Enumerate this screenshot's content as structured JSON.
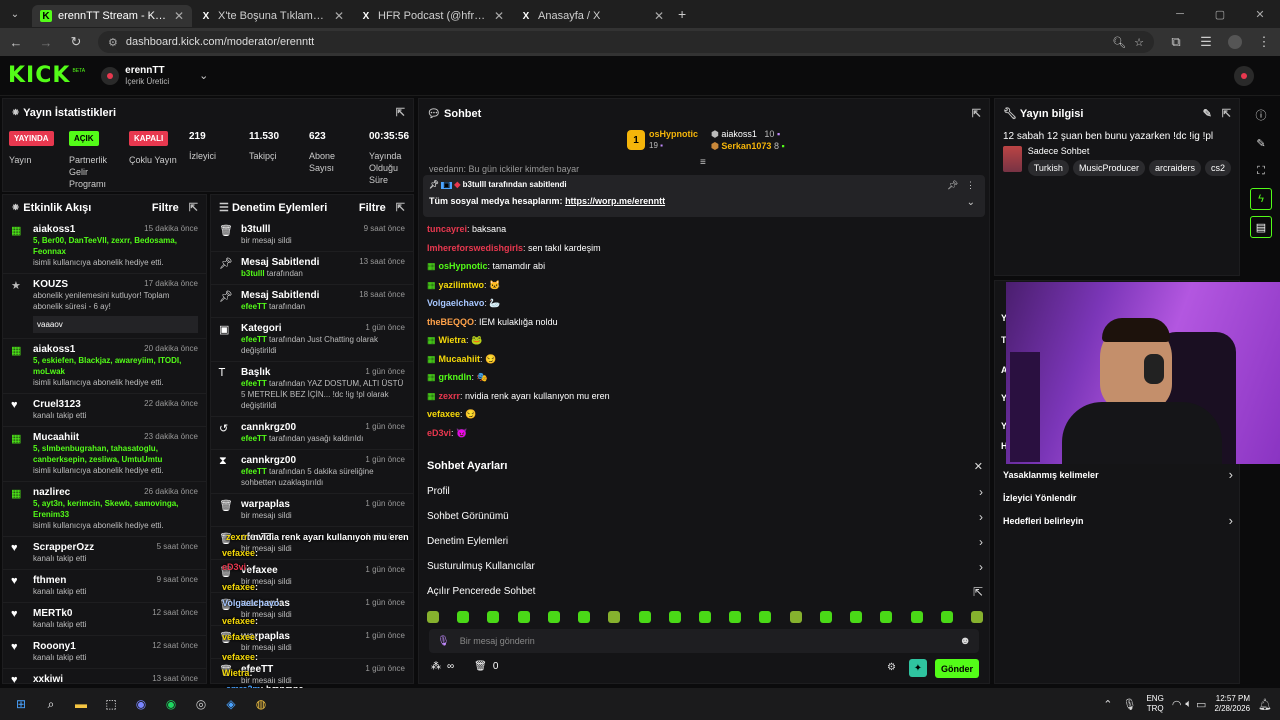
{
  "browser": {
    "tabs": [
      {
        "title": "erennTT Stream - Kick Dashboard",
        "fav": "K",
        "fav_color": "#53fc18"
      },
      {
        "title": "X'te Boşuna Tıklama: \"İran'ın bu",
        "fav": "X",
        "fav_color": "#ffffff"
      },
      {
        "title": "HFR Podcast (@hfrpodcast) / X",
        "fav": "X",
        "fav_color": "#ffffff"
      },
      {
        "title": "Anasayfa / X",
        "fav": "X",
        "fav_color": "#ffffff"
      }
    ],
    "url": "dashboard.kick.com/moderator/erenntt"
  },
  "header": {
    "logo": "KICK",
    "logo_beta": "BETA",
    "channel": "erennTT",
    "role": "İçerik Üretici"
  },
  "stats_panel": {
    "title": "Yayın İstatistikleri",
    "badges": [
      {
        "badge": "YAYINDA",
        "label": "Yayın",
        "color": "#e8384f"
      },
      {
        "badge": "AÇIK",
        "label": "Partnerlik Gelir Programı",
        "color": "#53fc18"
      },
      {
        "badge": "KAPALI",
        "label": "Çoklu Yayın",
        "color": "#e8384f"
      }
    ],
    "numbers": [
      {
        "value": "219",
        "label": "İzleyici"
      },
      {
        "value": "11.530",
        "label": "Takipçi"
      },
      {
        "value": "623",
        "label": "Abone Sayısı"
      },
      {
        "value": "00:35:56",
        "label": "Yayında Olduğu Süre"
      }
    ]
  },
  "activity": {
    "title": "Etkinlik Akışı",
    "filter": "Filtre",
    "items": [
      {
        "name": "aiakoss1",
        "time": "15 dakika önce",
        "users": "5, Ber00, DanTeeVII, zexrr, Bedosama, Feonnax",
        "desc": "isimli kullanıcıya abonelik hediye etti.",
        "icon": "gift-icon"
      },
      {
        "name": "KOUZS",
        "time": "17 dakika önce",
        "desc": "abonelik yenilemesini kutluyor! Toplam abonelik süresi - 6 ay!",
        "note": "vaaaov",
        "icon": "star-icon"
      },
      {
        "name": "aiakoss1",
        "time": "20 dakika önce",
        "users": "5, eskiefen, Blackjaz, awareyiim, ITODI, moLwak",
        "desc": "isimli kullanıcıya abonelik hediye etti.",
        "icon": "gift-icon"
      },
      {
        "name": "Cruel3123",
        "time": "22 dakika önce",
        "desc": "kanalı takip etti",
        "icon": "heart-icon"
      },
      {
        "name": "Mucaahiit",
        "time": "23 dakika önce",
        "users": "5, slmbenbugrahan, tahasatoglu, canberksepin, zesliwa, UmtuUmtu",
        "desc": "isimli kullanıcıya abonelik hediye etti.",
        "icon": "gift-icon"
      },
      {
        "name": "nazlirec",
        "time": "26 dakika önce",
        "users": "5, ayt3n, kerimcin, Skewb, samovinga, Erenim33",
        "desc": "isimli kullanıcıya abonelik hediye etti.",
        "icon": "gift-icon"
      },
      {
        "name": "ScrapperOzz",
        "time": "5 saat önce",
        "desc": "kanalı takip etti",
        "icon": "heart-icon"
      },
      {
        "name": "fthmen",
        "time": "9 saat önce",
        "desc": "kanalı takip etti",
        "icon": "heart-icon"
      },
      {
        "name": "MERTk0",
        "time": "12 saat önce",
        "desc": "kanalı takip etti",
        "icon": "heart-icon"
      },
      {
        "name": "Rooony1",
        "time": "12 saat önce",
        "desc": "kanalı takip etti",
        "icon": "heart-icon"
      },
      {
        "name": "xxkiwi",
        "time": "13 saat önce",
        "desc": "kanalı takip etti",
        "icon": "heart-icon"
      }
    ]
  },
  "modlog": {
    "title": "Denetim Eylemleri",
    "filter": "Filtre",
    "items": [
      {
        "name": "b3tulll",
        "time": "9 saat önce",
        "desc": "bir mesajı sildi",
        "icon": "trash-icon"
      },
      {
        "name": "Mesaj Sabitlendi",
        "time": "13 saat önce",
        "actor": "b3tulll",
        "desc": " tarafından",
        "icon": "pin-icon"
      },
      {
        "name": "Mesaj Sabitlendi",
        "time": "18 saat önce",
        "actor": "efeeTT",
        "desc": " tarafından",
        "icon": "pin-icon"
      },
      {
        "name": "Kategori",
        "time": "1 gün önce",
        "actor": "efeeTT",
        "desc": " tarafından Just Chatting olarak değiştirildi",
        "icon": "category-icon"
      },
      {
        "name": "Başlık",
        "time": "1 gün önce",
        "actor": "efeeTT",
        "desc": " tarafından YAZ DOSTUM, ALTI ÜSTÜ 5 METRELİK BEZ İÇİN... !dc !ig !pl olarak değiştirildi",
        "icon": "text-icon"
      },
      {
        "name": "cannkrgz00",
        "time": "1 gün önce",
        "actor": "efeeTT",
        "desc": " tarafından yasağı kaldırıldı",
        "icon": "unban-icon"
      },
      {
        "name": "cannkrgz00",
        "time": "1 gün önce",
        "actor": "efeeTT",
        "desc": " tarafından 5 dakika süreliğine sohbetten uzaklaştırıldı",
        "icon": "timeout-icon"
      },
      {
        "name": "warpaplas",
        "time": "1 gün önce",
        "desc": "bir mesajı sildi",
        "icon": "trash-icon"
      },
      {
        "name": "efeeTT",
        "time": "1 gün önce",
        "desc": "bir mesajı sildi",
        "icon": "trash-icon"
      },
      {
        "name": "vefaxee",
        "time": "1 gün önce",
        "desc": "bir mesajı sildi",
        "icon": "trash-icon"
      },
      {
        "name": "warpaplas",
        "time": "1 gün önce",
        "desc": "bir mesajı sildi",
        "icon": "trash-icon"
      },
      {
        "name": "warpaplas",
        "time": "1 gün önce",
        "desc": "bir mesajı sildi",
        "icon": "trash-icon"
      },
      {
        "name": "efeeTT",
        "time": "1 gün önce",
        "desc": "bir mesajı sildi",
        "icon": "trash-icon"
      }
    ]
  },
  "chat": {
    "title": "Sohbet",
    "top_gifters": [
      {
        "name": "osHypnotic",
        "count": "19",
        "rank": "1"
      },
      {
        "name": "aiakoss1",
        "count": "10"
      },
      {
        "name": "Serkan1073",
        "count": "8"
      }
    ],
    "pinned_by": "b3tulll tarafından sabitlendi",
    "pinned_text": "Tüm sosyal medya hesaplarım: ",
    "pinned_link": "https://worp.me/erenntt",
    "partial_top": "veedann: Bu gün ickiler kimden bayar",
    "messages": [
      {
        "user": "tuncayrei",
        "color": "#e8384f",
        "text": "baksana"
      },
      {
        "user": "Imhereforswedishgirls",
        "color": "#e8384f",
        "text": "sen takıl kardeşim"
      },
      {
        "user": "osHypnotic",
        "color": "#53fc18",
        "text": "tamamdır abi"
      },
      {
        "user": "yazilimtwo",
        "color": "#f5d90a",
        "text": "🐱"
      },
      {
        "user": "Volgaelchavo",
        "color": "#a7c7ff",
        "text": "🦢"
      },
      {
        "user": "theBEQQO",
        "color": "#ffa24a",
        "text": "IEM kulaklığa noldu"
      },
      {
        "user": "Wietra",
        "color": "#f5d90a",
        "text": "🐸"
      },
      {
        "user": "Mucaahiit",
        "color": "#f5d90a",
        "text": "😏"
      },
      {
        "user": "grkndln",
        "color": "#53fc18",
        "text": "🎭"
      },
      {
        "user": "zexrr",
        "color": "#e8384f",
        "text": "nvidia renk ayarı kullanıyon mu eren"
      },
      {
        "user": "vefaxee",
        "color": "#f5d90a",
        "text": "😏"
      },
      {
        "user": "eD3vi",
        "color": "#e8384f",
        "text": "😈"
      }
    ],
    "settings": {
      "title": "Sohbet Ayarları",
      "rows": [
        "Profil",
        "Sohbet Görünümü",
        "Denetim Eylemleri",
        "Susturulmuş Kullanıcılar",
        "Açılır Pencerede Sohbet"
      ]
    },
    "placeholder": "Bir mesaj gönderin",
    "viewer_count": "∞",
    "count2": "0",
    "send": "Gönder"
  },
  "info": {
    "title": "Yayın bilgisi",
    "stream_title": "12 sabah 12 şuan ben bunu yazarken !dc !ig !pl",
    "category": "Sadece Sohbet",
    "tags": [
      "Turkish",
      "MusicProducer",
      "arcraiders",
      "cs2"
    ],
    "menu": [
      "Yasaklanmış kelimeler",
      "İzleyici Yönlendir",
      "Hedefleri belirleyin"
    ],
    "hidden_labels": [
      "Yü",
      "Ta",
      "Al",
      "Ya",
      "Ya",
      "Hi"
    ]
  },
  "overlay_chat": [
    {
      "user": "zexrr",
      "text": ": nvidia renk ayarı kullanıyon mu eren",
      "color": "#f5d90a"
    },
    {
      "user": "vefaxee",
      "text": ":",
      "color": "#f5d90a"
    },
    {
      "user": "eD3vi",
      "text": ":",
      "color": "#e8384f"
    },
    {
      "user": "vefaxee",
      "text": ":",
      "color": "#f5d90a"
    },
    {
      "user": "Volgaelchavo",
      "text": ":",
      "color": "#a7c7ff"
    },
    {
      "user": "vefaxee",
      "text": ":",
      "color": "#f5d90a"
    },
    {
      "user": "vefaxee",
      "text": ":",
      "color": "#f5d90a"
    },
    {
      "user": "vefaxee",
      "text": ":",
      "color": "#f5d90a"
    },
    {
      "user": "Wietra",
      "text": ":",
      "color": "#f5d90a"
    },
    {
      "user": "emre2m",
      "text": ": bænæne",
      "color": "#4aa3ff"
    },
    {
      "user": "someotherproblems",
      "text": ": as hg gelenler",
      "color": "#4aa3ff"
    }
  ],
  "taskbar": {
    "lang1": "ENG",
    "lang2": "TRQ",
    "time": "12:57 PM",
    "date": "2/28/2026"
  }
}
